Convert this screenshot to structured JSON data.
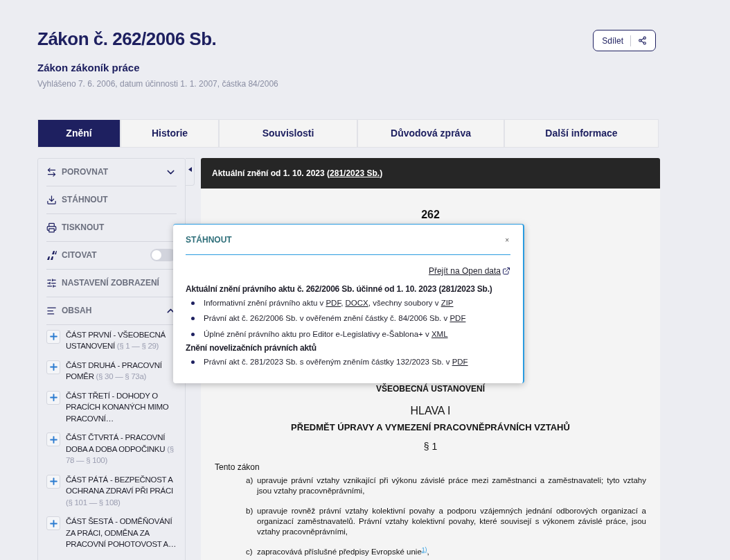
{
  "header": {
    "title": "Zákon č. 262/2006 Sb.",
    "subtitle": "Zákon zákoník práce",
    "meta": "Vyhlášeno 7. 6. 2006, datum účinnosti 1. 1. 2007, částka 84/2006",
    "share_label": "Sdílet"
  },
  "tabs": [
    {
      "label": "Znění",
      "selected": true
    },
    {
      "label": "Historie",
      "selected": false
    },
    {
      "label": "Souvislosti",
      "selected": false
    },
    {
      "label": "Důvodová zpráva",
      "selected": false
    },
    {
      "label": "Další informace",
      "selected": false
    }
  ],
  "sidebar": {
    "actions": [
      {
        "kind": "dropdown",
        "label": "POROVNAT",
        "expanded": false
      },
      {
        "kind": "plain",
        "label": "STÁHNOUT"
      },
      {
        "kind": "plain",
        "label": "TISKNOUT"
      },
      {
        "kind": "toggle",
        "label": "CITOVAT",
        "on": false
      },
      {
        "kind": "plain",
        "label": "NASTAVENÍ ZOBRAZENÍ"
      },
      {
        "kind": "dropdown",
        "label": "OBSAH",
        "expanded": true
      }
    ],
    "contents": [
      {
        "title": "ČÁST PRVNÍ - VŠEOBECNÁ USTANOVENÍ",
        "range": "(§ 1 — § 29)",
        "expanded": false
      },
      {
        "title": "ČÁST DRUHÁ - PRACOVNÍ POMĚR",
        "range": "(§ 30 — § 73a)",
        "expanded": false
      },
      {
        "title": "ČÁST TŘETÍ - DOHODY O PRACÍCH KONANÝCH MIMO PRACOVNÍ…",
        "expanded": false
      },
      {
        "title": "ČÁST ČTVRTÁ - PRACOVNÍ DOBA A DOBA ODPOČINKU",
        "range": "(§ 78 — § 100)",
        "expanded": false
      },
      {
        "title": "ČÁST PÁTÁ - BEZPEČNOST A OCHRANA ZDRAVÍ PŘI PRÁCI",
        "range": "(§ 101 — § 108)",
        "expanded": false
      },
      {
        "title": "ČÁST ŠESTÁ - ODMĚŇOVÁNÍ ZA PRÁCI, ODMĚNA ZA PRACOVNÍ POHOTOVOST A…",
        "expanded": false
      }
    ]
  },
  "document": {
    "banner": {
      "text": "Aktuální znění od 1. 10. 2023 (",
      "link": "281/2023 Sb.",
      "tail": ")"
    },
    "number": "262",
    "part_name": "VŠEOBECNÁ USTANOVENÍ",
    "chapter": "HLAVA I",
    "chapter_title": "PŘEDMĚT ÚPRAVY A VYMEZENÍ PRACOVNĚPRÁVNÍCH VZTAHŮ",
    "section": "§ 1",
    "intro": "Tento zákon",
    "points": [
      {
        "mark": "a)",
        "text": "upravuje právní vztahy vznikající při výkonu závislé práce mezi zaměstnanci a zaměstnavateli; tyto vztahy jsou vztahy pracovněprávními,"
      },
      {
        "mark": "b)",
        "text": "upravuje rovněž právní vztahy kolektivní povahy a podporu vzájemných jednání odborových organizací a organizací zaměstnavatelů. Právní vztahy kolektivní povahy, které souvisejí s výkonem závislé práce, jsou vztahy pracovněprávními,"
      },
      {
        "mark": "c)",
        "text": "zapracovává příslušné předpisy Evropské unie",
        "footnote": "1)",
        "tail": ","
      }
    ]
  },
  "download_popup": {
    "title": "STÁHNOUT",
    "close": "×",
    "open_data_link": "Přejít na Open data",
    "groups": [
      {
        "heading": "Aktuální znění právního aktu č. 262/2006 Sb. účinné od 1. 10. 2023 (281/2023 Sb.)",
        "items": [
          [
            {
              "text": "Informativní znění právního aktu v "
            },
            {
              "link": "PDF"
            },
            {
              "text": ", "
            },
            {
              "link": "DOCX"
            },
            {
              "text": ", všechny soubory v "
            },
            {
              "link": "ZIP"
            }
          ],
          [
            {
              "text": "Právní akt č. 262/2006 Sb. v ověřeném znění částky č. 84/2006 Sb. v "
            },
            {
              "link": "PDF"
            }
          ],
          [
            {
              "text": "Úplné znění právního aktu pro Editor e-Legislativy e-Šablona+ v "
            },
            {
              "link": "XML"
            }
          ]
        ]
      },
      {
        "heading": "Znění novelizačních právních aktů",
        "items": [
          [
            {
              "text": "Právní akt č. 281/2023 Sb. s ověřeným zněním částky 132/2023 Sb. v "
            },
            {
              "link": "PDF"
            }
          ]
        ]
      }
    ]
  }
}
